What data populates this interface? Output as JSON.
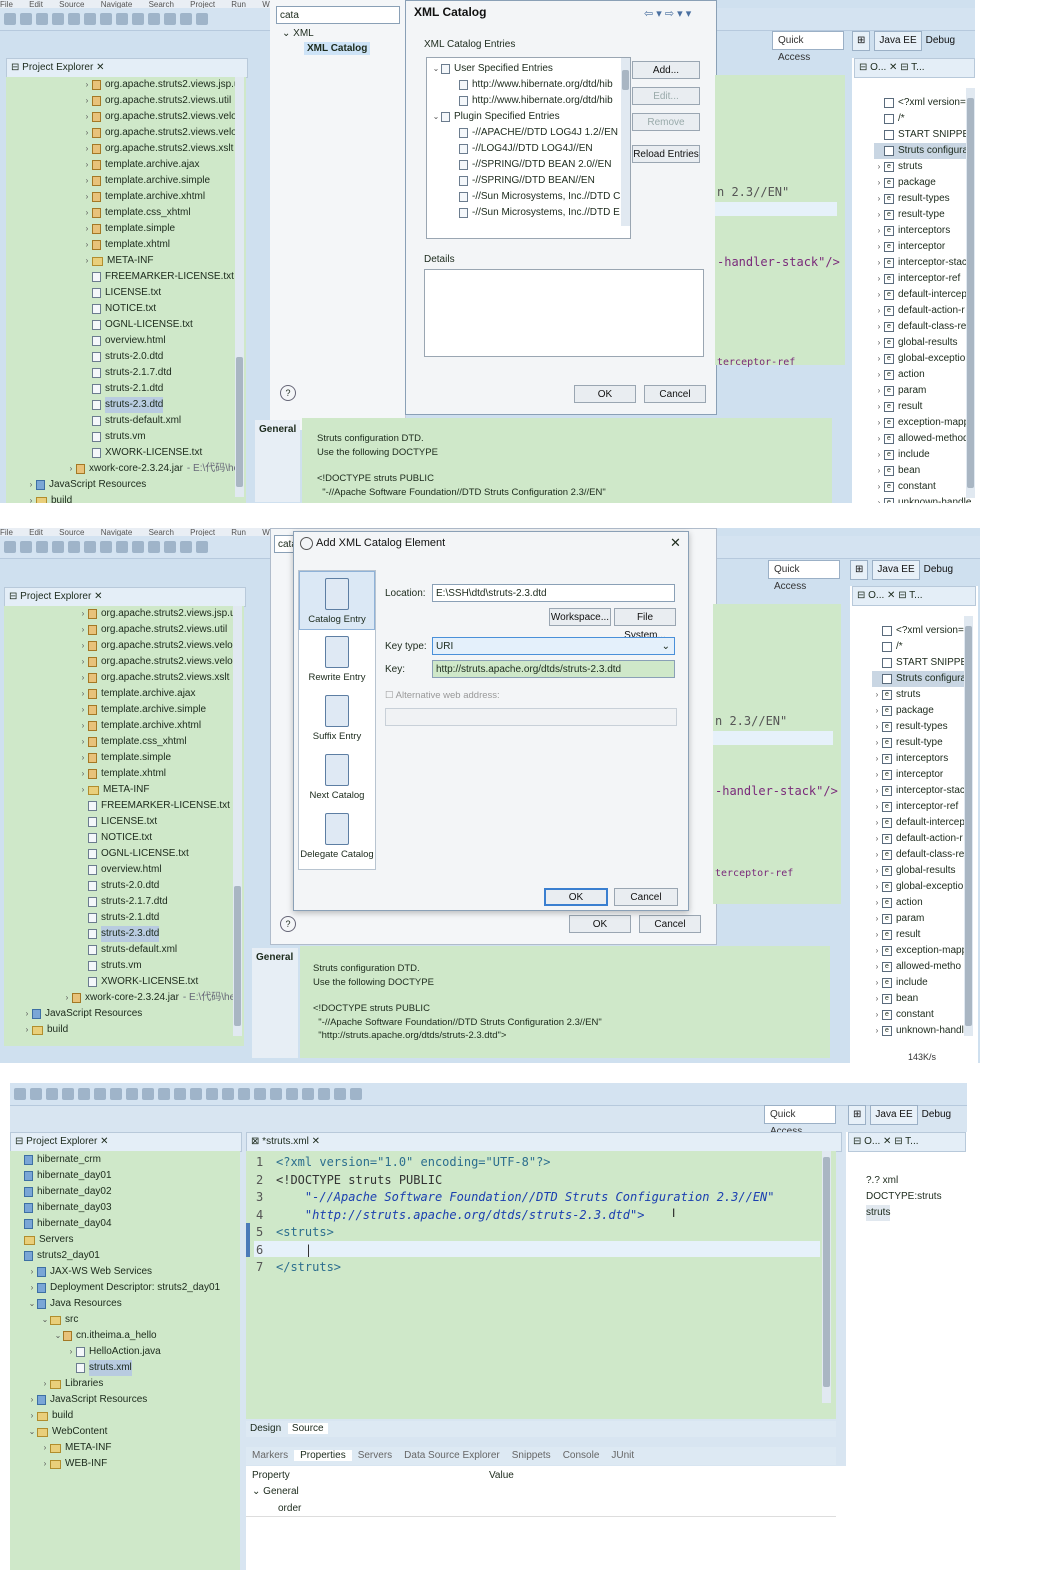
{
  "menu": [
    "File",
    "Edit",
    "Source",
    "Navigate",
    "Search",
    "Project",
    "Run",
    "Window"
  ],
  "quick_access": "Quick Access",
  "perspectives": [
    "Java EE",
    "Debug"
  ],
  "project_explorer_title": "Project Explorer",
  "panel1": {
    "search_text": "cata",
    "pref_tree": [
      "XML",
      "XML Catalog"
    ],
    "dialog": {
      "title": "XML Catalog",
      "entries_label": "XML Catalog Entries",
      "entries": [
        {
          "label": "User Specified Entries",
          "level": 0
        },
        {
          "label": "http://www.hibernate.org/dtd/hib",
          "level": 1
        },
        {
          "label": "http://www.hibernate.org/dtd/hib",
          "level": 1
        },
        {
          "label": "Plugin Specified Entries",
          "level": 0
        },
        {
          "label": "-//APACHE//DTD LOG4J 1.2//EN",
          "level": 1
        },
        {
          "label": "-//LOG4J//DTD LOG4J//EN",
          "level": 1
        },
        {
          "label": "-//SPRING//DTD BEAN 2.0//EN",
          "level": 1
        },
        {
          "label": "-//SPRING//DTD BEAN//EN",
          "level": 1
        },
        {
          "label": "-//Sun Microsystems, Inc.//DTD C",
          "level": 1
        },
        {
          "label": "-//Sun Microsystems, Inc.//DTD E",
          "level": 1
        }
      ],
      "buttons": {
        "add": "Add...",
        "edit": "Edit...",
        "remove": "Remove",
        "reload": "Reload Entries"
      },
      "details_label": "Details",
      "ok": "OK",
      "cancel": "Cancel"
    },
    "explorer_items": [
      {
        "label": "org.apache.struts2.views.jsp.ui",
        "icon": "pkg"
      },
      {
        "label": "org.apache.struts2.views.util",
        "icon": "pkg"
      },
      {
        "label": "org.apache.struts2.views.veloci",
        "icon": "pkg"
      },
      {
        "label": "org.apache.struts2.views.veloci",
        "icon": "pkg"
      },
      {
        "label": "org.apache.struts2.views.xslt",
        "icon": "pkg"
      },
      {
        "label": "template.archive.ajax",
        "icon": "pkg"
      },
      {
        "label": "template.archive.simple",
        "icon": "pkg"
      },
      {
        "label": "template.archive.xhtml",
        "icon": "pkg"
      },
      {
        "label": "template.css_xhtml",
        "icon": "pkg"
      },
      {
        "label": "template.simple",
        "icon": "pkg"
      },
      {
        "label": "template.xhtml",
        "icon": "pkg"
      },
      {
        "label": "META-INF",
        "icon": "folder"
      },
      {
        "label": "FREEMARKER-LICENSE.txt",
        "icon": "file"
      },
      {
        "label": "LICENSE.txt",
        "icon": "file"
      },
      {
        "label": "NOTICE.txt",
        "icon": "file"
      },
      {
        "label": "OGNL-LICENSE.txt",
        "icon": "file"
      },
      {
        "label": "overview.html",
        "icon": "file"
      },
      {
        "label": "struts-2.0.dtd",
        "icon": "file"
      },
      {
        "label": "struts-2.1.7.dtd",
        "icon": "file"
      },
      {
        "label": "struts-2.1.dtd",
        "icon": "file"
      },
      {
        "label": "struts-2.3.dtd",
        "icon": "file"
      },
      {
        "label": "struts-default.xml",
        "icon": "file"
      },
      {
        "label": "struts.vm",
        "icon": "file"
      },
      {
        "label": "XWORK-LICENSE.txt",
        "icon": "file"
      },
      {
        "label": "xwork-core-2.3.24.jar",
        "icon": "pkg"
      },
      {
        "label": "JavaScript Resources",
        "icon": "proj"
      },
      {
        "label": "build",
        "icon": "folder"
      }
    ],
    "jar_suffix": "- E:\\代码\\hei",
    "editor_fragments": [
      "n 2.3//EN\"",
      "-handler-stack\"/>",
      "terceptor-ref"
    ],
    "general_tab": "General",
    "doc_lines": [
      "Struts configuration DTD.",
      "Use the following DOCTYPE",
      "",
      "<!DOCTYPE struts PUBLIC",
      "  \"-//Apache Software Foundation//DTD Struts Configuration 2.3//EN\""
    ],
    "outline_items": [
      "<?xml version=",
      "/*",
      "START SNIPPET",
      "Struts configura",
      "struts",
      "package",
      "result-types",
      "result-type",
      "interceptors",
      "interceptor",
      "interceptor-stac",
      "interceptor-ref",
      "default-intercep",
      "default-action-r",
      "default-class-re",
      "global-results",
      "global-exceptio",
      "action",
      "param",
      "result",
      "exception-mapp",
      "allowed-method",
      "include",
      "bean",
      "constant",
      "unknown-handle"
    ]
  },
  "panel2": {
    "search_text": "cata",
    "dialog": {
      "title": "Add XML Catalog Element",
      "side_items": [
        "Catalog Entry",
        "Rewrite Entry",
        "Suffix Entry",
        "Next Catalog",
        "Delegate Catalog"
      ],
      "location_label": "Location:",
      "location_value": "E:\\SSH\\dtd\\struts-2.3.dtd",
      "workspace_btn": "Workspace...",
      "filesystem_btn": "File System...",
      "key_type_label": "Key type:",
      "key_type_value": "URI",
      "key_label": "Key:",
      "key_value": "http://struts.apache.org/dtds/struts-2.3.dtd",
      "alt_label": "Alternative web address:",
      "ok": "OK",
      "cancel": "Cancel"
    },
    "behind_ok": "OK",
    "behind_cancel": "Cancel",
    "explorer_items": [
      {
        "label": "org.apache.struts2.views.jsp.ui",
        "icon": "pkg"
      },
      {
        "label": "org.apache.struts2.views.util",
        "icon": "pkg"
      },
      {
        "label": "org.apache.struts2.views.veloci",
        "icon": "pkg"
      },
      {
        "label": "org.apache.struts2.views.veloci",
        "icon": "pkg"
      },
      {
        "label": "org.apache.struts2.views.xslt",
        "icon": "pkg"
      },
      {
        "label": "template.archive.ajax",
        "icon": "pkg"
      },
      {
        "label": "template.archive.simple",
        "icon": "pkg"
      },
      {
        "label": "template.archive.xhtml",
        "icon": "pkg"
      },
      {
        "label": "template.css_xhtml",
        "icon": "pkg"
      },
      {
        "label": "template.simple",
        "icon": "pkg"
      },
      {
        "label": "template.xhtml",
        "icon": "pkg"
      },
      {
        "label": "META-INF",
        "icon": "folder"
      },
      {
        "label": "FREEMARKER-LICENSE.txt",
        "icon": "file"
      },
      {
        "label": "LICENSE.txt",
        "icon": "file"
      },
      {
        "label": "NOTICE.txt",
        "icon": "file"
      },
      {
        "label": "OGNL-LICENSE.txt",
        "icon": "file"
      },
      {
        "label": "overview.html",
        "icon": "file"
      },
      {
        "label": "struts-2.0.dtd",
        "icon": "file"
      },
      {
        "label": "struts-2.1.7.dtd",
        "icon": "file"
      },
      {
        "label": "struts-2.1.dtd",
        "icon": "file"
      },
      {
        "label": "struts-2.3.dtd",
        "icon": "file"
      },
      {
        "label": "struts-default.xml",
        "icon": "file"
      },
      {
        "label": "struts.vm",
        "icon": "file"
      },
      {
        "label": "XWORK-LICENSE.txt",
        "icon": "file"
      },
      {
        "label": "xwork-core-2.3.24.jar",
        "icon": "pkg"
      },
      {
        "label": "JavaScript Resources",
        "icon": "proj"
      },
      {
        "label": "build",
        "icon": "folder"
      }
    ],
    "jar_suffix": "- E:\\代码\\hei",
    "editor_fragments": [
      "n 2.3//EN\"",
      "-handler-stack\"/>",
      "terceptor-ref"
    ],
    "general_tab": "General",
    "doc_lines": [
      "Struts configuration DTD.",
      "Use the following DOCTYPE",
      "",
      "<!DOCTYPE struts PUBLIC",
      "  \"-//Apache Software Foundation//DTD Struts Configuration 2.3//EN\"",
      "  \"http://struts.apache.org/dtds/struts-2.3.dtd\">"
    ],
    "outline_items": [
      "<?xml version=",
      "/*",
      "START SNIPPET",
      "Struts configura",
      "struts",
      "package",
      "result-types",
      "result-type",
      "interceptors",
      "interceptor",
      "interceptor-stac",
      "interceptor-ref",
      "default-intercep",
      "default-action-r",
      "default-class-re",
      "global-results",
      "global-exceptio",
      "action",
      "param",
      "result",
      "exception-mapp",
      "allowed-metho",
      "include",
      "bean",
      "constant",
      "unknown-handl"
    ],
    "net_speed": "143K/s"
  },
  "panel3": {
    "explorer_items": [
      {
        "label": "hibernate_crm",
        "level": 0,
        "icon": "proj",
        "chev": ""
      },
      {
        "label": "hibernate_day01",
        "level": 0,
        "icon": "proj",
        "chev": ""
      },
      {
        "label": "hibernate_day02",
        "level": 0,
        "icon": "proj",
        "chev": ""
      },
      {
        "label": "hibernate_day03",
        "level": 0,
        "icon": "proj",
        "chev": ""
      },
      {
        "label": "hibernate_day04",
        "level": 0,
        "icon": "proj",
        "chev": ""
      },
      {
        "label": "Servers",
        "level": 0,
        "icon": "folder",
        "chev": ""
      },
      {
        "label": "struts2_day01",
        "level": 0,
        "icon": "proj",
        "chev": ""
      },
      {
        "label": "JAX-WS Web Services",
        "level": 1,
        "icon": "proj",
        "chev": "›"
      },
      {
        "label": "Deployment Descriptor: struts2_day01",
        "level": 1,
        "icon": "proj",
        "chev": "›"
      },
      {
        "label": "Java Resources",
        "level": 1,
        "icon": "proj",
        "chev": "⌄"
      },
      {
        "label": "src",
        "level": 2,
        "icon": "folder",
        "chev": "⌄"
      },
      {
        "label": "cn.itheima.a_hello",
        "level": 3,
        "icon": "pkg",
        "chev": "⌄"
      },
      {
        "label": "HelloAction.java",
        "level": 4,
        "icon": "file",
        "chev": "›"
      },
      {
        "label": "struts.xml",
        "level": 4,
        "icon": "file",
        "chev": ""
      },
      {
        "label": "Libraries",
        "level": 2,
        "icon": "folder",
        "chev": "›"
      },
      {
        "label": "JavaScript Resources",
        "level": 1,
        "icon": "proj",
        "chev": "›"
      },
      {
        "label": "build",
        "level": 1,
        "icon": "folder",
        "chev": "›"
      },
      {
        "label": "WebContent",
        "level": 1,
        "icon": "folder",
        "chev": "⌄"
      },
      {
        "label": "META-INF",
        "level": 2,
        "icon": "folder",
        "chev": "›"
      },
      {
        "label": "WEB-INF",
        "level": 2,
        "icon": "folder",
        "chev": "›"
      }
    ],
    "editor_tab": "*struts.xml",
    "code_lines": [
      {
        "n": "1",
        "text": "<?xml version=\"1.0\" encoding=\"UTF-8\"?>"
      },
      {
        "n": "2",
        "text": "<!DOCTYPE struts PUBLIC"
      },
      {
        "n": "3",
        "text": "    \"-//Apache Software Foundation//DTD Struts Configuration 2.3//EN\""
      },
      {
        "n": "4",
        "text": "    \"http://struts.apache.org/dtds/struts-2.3.dtd\">"
      },
      {
        "n": "5",
        "text": "<struts>"
      },
      {
        "n": "6",
        "text": "    |"
      },
      {
        "n": "7",
        "text": "</struts>"
      }
    ],
    "bottom_tabs": [
      "Design",
      "Source"
    ],
    "views_tabs": [
      "Markers",
      "Properties",
      "Servers",
      "Data Source Explorer",
      "Snippets",
      "Console",
      "JUnit"
    ],
    "prop_headers": [
      "Property",
      "Value"
    ],
    "prop_group": "General",
    "prop_row": "order",
    "outline_items": [
      "?.? xml",
      "DOCTYPE:struts",
      "struts"
    ]
  }
}
